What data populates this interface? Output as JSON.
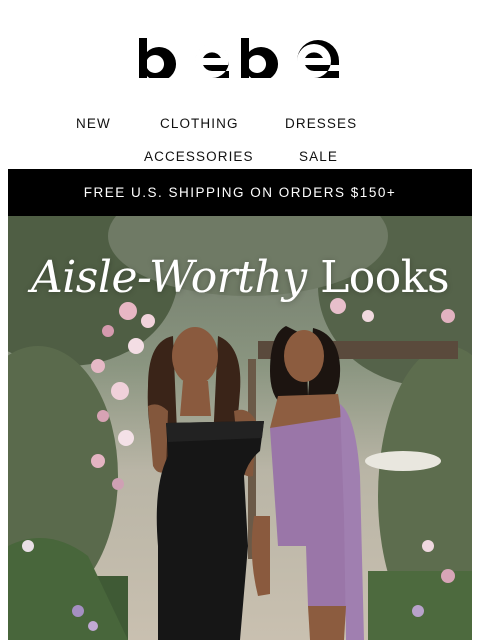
{
  "brand": {
    "logo_text": "bebe"
  },
  "nav": {
    "items": [
      {
        "label": "NEW"
      },
      {
        "label": "CLOTHING"
      },
      {
        "label": "DRESSES"
      },
      {
        "label": "ACCESSORIES"
      },
      {
        "label": "SALE"
      }
    ]
  },
  "promo": {
    "text": "FREE U.S. SHIPPING ON ORDERS $150+"
  },
  "hero": {
    "title_italic": "Aisle-Worthy",
    "title_rest": " Looks"
  },
  "colors": {
    "promo_bg": "#000000",
    "hero_text": "#ffffff",
    "dress_black": "#141414",
    "dress_lilac": "#9a76a8"
  },
  "icons": [
    "logo-wordmark"
  ]
}
